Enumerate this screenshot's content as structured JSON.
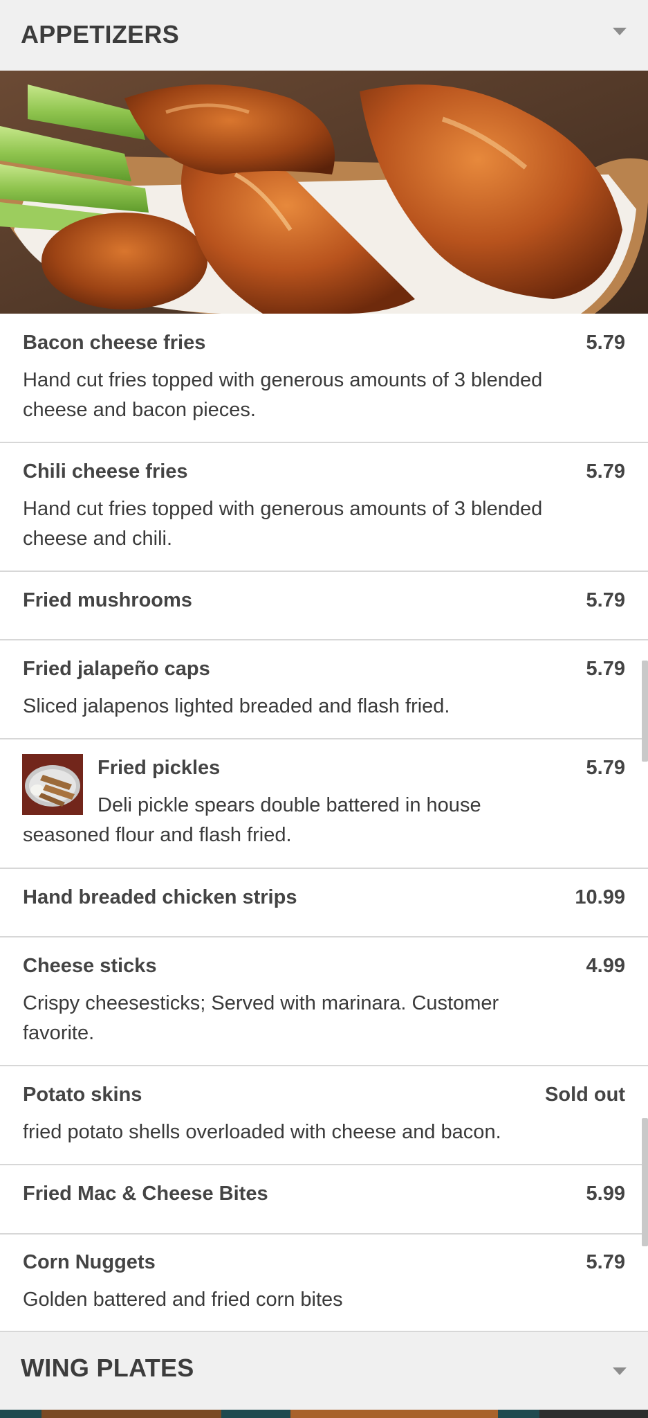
{
  "sections": {
    "appetizers": {
      "title": "APPETIZERS"
    },
    "wing_plates": {
      "title": "WING PLATES"
    }
  },
  "icons": {
    "caret": "chevron-down-icon"
  },
  "items": [
    {
      "name": "Bacon cheese fries",
      "price": "5.79",
      "description": "Hand cut fries topped with generous amounts of 3 blended cheese and bacon pieces."
    },
    {
      "name": "Chili cheese fries",
      "price": "5.79",
      "description": "Hand cut fries topped with generous amounts of 3 blended cheese and chili."
    },
    {
      "name": "Fried mushrooms",
      "price": "5.79",
      "description": ""
    },
    {
      "name": "Fried jalapeño caps",
      "price": "5.79",
      "description": "Sliced jalapenos lighted breaded and flash fried."
    },
    {
      "name": "Fried pickles",
      "price": "5.79",
      "description": "Deli pickle spears double battered in house seasoned flour and flash fried."
    },
    {
      "name": "Hand breaded chicken strips",
      "price": "10.99",
      "description": ""
    },
    {
      "name": "Cheese sticks",
      "price": "4.99",
      "description": "Crispy cheesesticks; Served with marinara. Customer favorite."
    },
    {
      "name": "Potato skins",
      "price": "Sold out",
      "description": "fried potato shells overloaded with cheese and bacon."
    },
    {
      "name": "Fried Mac & Cheese Bites",
      "price": "5.99",
      "description": ""
    },
    {
      "name": "Corn Nuggets",
      "price": "5.79",
      "description": "Golden battered and fried corn bites"
    }
  ]
}
